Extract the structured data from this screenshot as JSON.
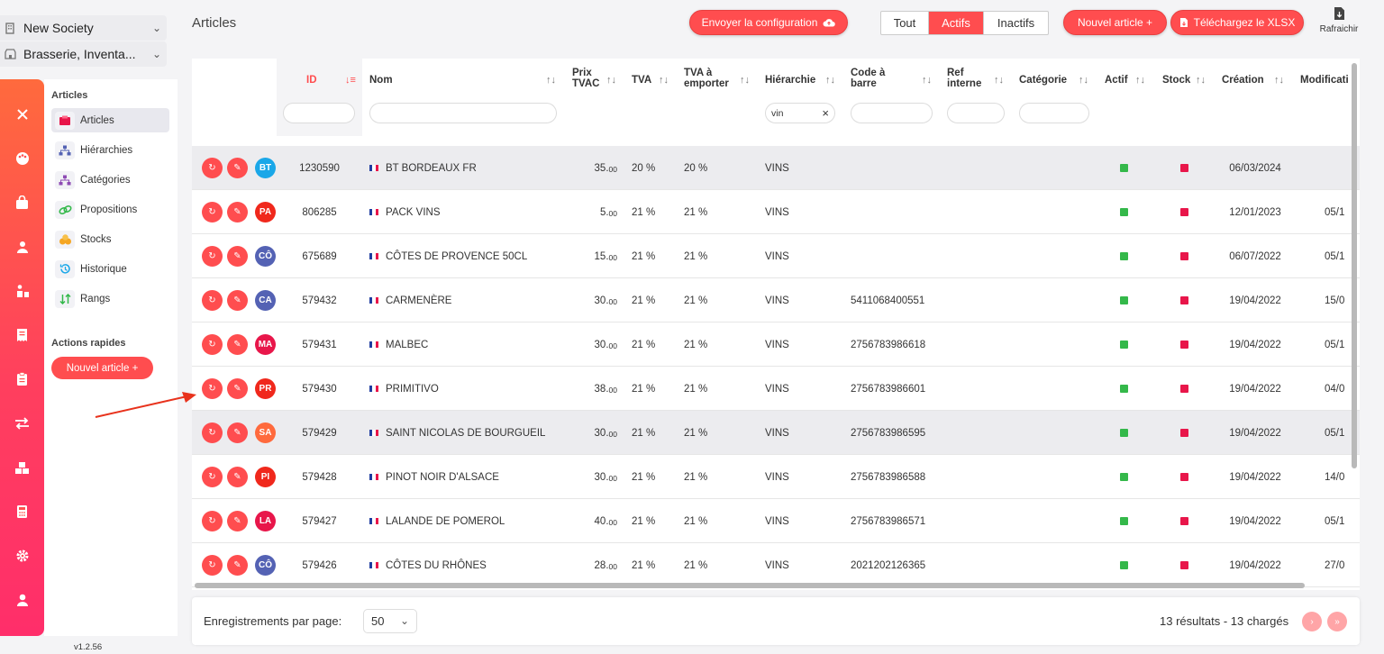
{
  "org_selector": {
    "label": "New Society",
    "icon": "building-icon"
  },
  "site_selector": {
    "label": "Brasserie, Inventa...",
    "icon": "store-icon"
  },
  "rail_icons": [
    "close-icon",
    "palette-icon",
    "shopping-bag-icon",
    "people-icon",
    "worker-icon",
    "receipt-icon",
    "clipboard-icon",
    "transfer-icon",
    "boxes-icon",
    "calculator-icon",
    "gear-icon",
    "user-icon"
  ],
  "submenu": {
    "section_label": "Articles",
    "items": [
      {
        "label": "Articles",
        "icon": "cube-icon"
      },
      {
        "label": "Hiérarchies",
        "icon": "hierarchy-icon"
      },
      {
        "label": "Catégories",
        "icon": "category-icon"
      },
      {
        "label": "Propositions",
        "icon": "link-icon"
      },
      {
        "label": "Stocks",
        "icon": "stocks-icon"
      },
      {
        "label": "Historique",
        "icon": "history-icon"
      },
      {
        "label": "Rangs",
        "icon": "sort-icon"
      }
    ],
    "quick_label": "Actions rapides",
    "quick_button": "Nouvel article +"
  },
  "version": "v1.2.56",
  "header": {
    "title": "Articles",
    "send_config": "Envoyer la configuration",
    "filters": [
      "Tout",
      "Actifs",
      "Inactifs"
    ],
    "active_filter": "Actifs",
    "new_article": "Nouvel article  +",
    "download": "Téléchargez le XLSX",
    "refresh": "Rafraichir"
  },
  "table": {
    "columns": [
      {
        "key": "id",
        "label": "ID"
      },
      {
        "key": "name",
        "label": "Nom"
      },
      {
        "key": "price",
        "label": "Prix TVAC"
      },
      {
        "key": "tva",
        "label": "TVA"
      },
      {
        "key": "tva_takeaway",
        "label": "TVA à emporter"
      },
      {
        "key": "hierarchy",
        "label": "Hiérarchie"
      },
      {
        "key": "barcode",
        "label": "Code à barre"
      },
      {
        "key": "ref",
        "label": "Ref interne"
      },
      {
        "key": "category",
        "label": "Catégorie"
      },
      {
        "key": "active",
        "label": "Actif"
      },
      {
        "key": "stock",
        "label": "Stock"
      },
      {
        "key": "created",
        "label": "Création"
      },
      {
        "key": "modified",
        "label": "Modificati"
      }
    ],
    "hierarchy_filter": "vin",
    "rows": [
      {
        "initials": "BT",
        "color": "#1aa7e8",
        "id": "1230590",
        "name": "BT BORDEAUX FR",
        "price": "35.",
        "cents": "00",
        "tva": "20 %",
        "tva_takeaway": "20 %",
        "hierarchy": "VINS",
        "barcode": "",
        "created": "06/03/2024",
        "modified": ""
      },
      {
        "initials": "PA",
        "color": "#f0281c",
        "id": "806285",
        "name": "PACK VINS",
        "price": "5.",
        "cents": "00",
        "tva": "21 %",
        "tva_takeaway": "21 %",
        "hierarchy": "VINS",
        "barcode": "",
        "created": "12/01/2023",
        "modified": "05/1"
      },
      {
        "initials": "CÔ",
        "color": "#5462b4",
        "id": "675689",
        "name": "CÔTES DE PROVENCE 50CL",
        "price": "15.",
        "cents": "00",
        "tva": "21 %",
        "tva_takeaway": "21 %",
        "hierarchy": "VINS",
        "barcode": "",
        "created": "06/07/2022",
        "modified": "05/1"
      },
      {
        "initials": "CA",
        "color": "#5462b4",
        "id": "579432",
        "name": "CARMENÈRE",
        "price": "30.",
        "cents": "00",
        "tva": "21 %",
        "tva_takeaway": "21 %",
        "hierarchy": "VINS",
        "barcode": "5411068400551",
        "created": "19/04/2022",
        "modified": "15/0"
      },
      {
        "initials": "MA",
        "color": "#e8164a",
        "id": "579431",
        "name": "MALBEC",
        "price": "30.",
        "cents": "00",
        "tva": "21 %",
        "tva_takeaway": "21 %",
        "hierarchy": "VINS",
        "barcode": "2756783986618",
        "created": "19/04/2022",
        "modified": "05/1"
      },
      {
        "initials": "PR",
        "color": "#f0281c",
        "id": "579430",
        "name": "PRIMITIVO",
        "price": "38.",
        "cents": "00",
        "tva": "21 %",
        "tva_takeaway": "21 %",
        "hierarchy": "VINS",
        "barcode": "2756783986601",
        "created": "19/04/2022",
        "modified": "04/0"
      },
      {
        "initials": "SA",
        "color": "#ff6a3d",
        "id": "579429",
        "name": "SAINT NICOLAS DE BOURGUEIL",
        "price": "30.",
        "cents": "00",
        "tva": "21 %",
        "tva_takeaway": "21 %",
        "hierarchy": "VINS",
        "barcode": "2756783986595",
        "created": "19/04/2022",
        "modified": "05/1"
      },
      {
        "initials": "PI",
        "color": "#f0281c",
        "id": "579428",
        "name": "PINOT NOIR D'ALSACE",
        "price": "30.",
        "cents": "00",
        "tva": "21 %",
        "tva_takeaway": "21 %",
        "hierarchy": "VINS",
        "barcode": "2756783986588",
        "created": "19/04/2022",
        "modified": "14/0"
      },
      {
        "initials": "LA",
        "color": "#e8164a",
        "id": "579427",
        "name": "LALANDE DE POMEROL",
        "price": "40.",
        "cents": "00",
        "tva": "21 %",
        "tva_takeaway": "21 %",
        "hierarchy": "VINS",
        "barcode": "2756783986571",
        "created": "19/04/2022",
        "modified": "05/1"
      },
      {
        "initials": "CÔ",
        "color": "#5462b4",
        "id": "579426",
        "name": "CÔTES DU RHÔNES",
        "price": "28.",
        "cents": "00",
        "tva": "21 %",
        "tva_takeaway": "21 %",
        "hierarchy": "VINS",
        "barcode": "2021202126365",
        "created": "19/04/2022",
        "modified": "27/0"
      }
    ]
  },
  "footer": {
    "per_page_label": "Enregistrements par page:",
    "per_page": "50",
    "results": "13 résultats - 13 chargés"
  }
}
